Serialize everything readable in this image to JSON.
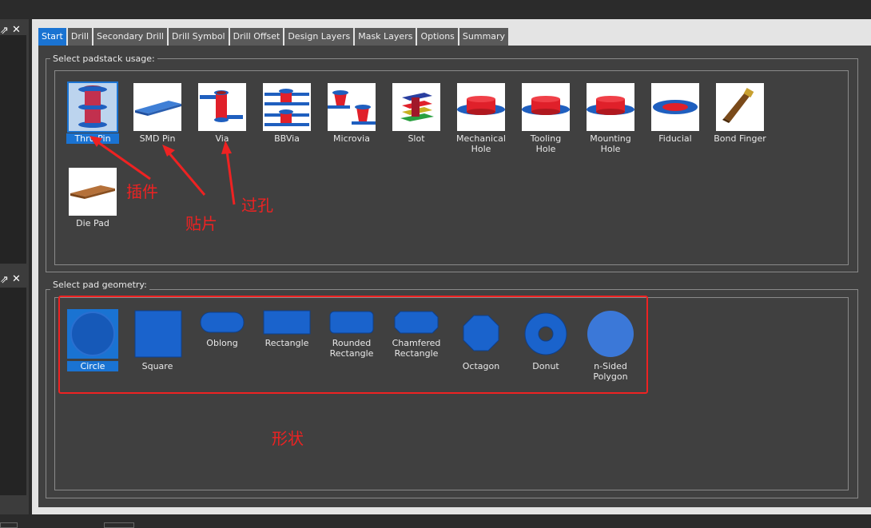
{
  "left_panel": {
    "btn_float": "⇗",
    "btn_close": "✕"
  },
  "tabs": [
    {
      "label": "Start",
      "active": true
    },
    {
      "label": "Drill"
    },
    {
      "label": "Secondary Drill"
    },
    {
      "label": "Drill Symbol"
    },
    {
      "label": "Drill Offset"
    },
    {
      "label": "Design Layers"
    },
    {
      "label": "Mask Layers"
    },
    {
      "label": "Options"
    },
    {
      "label": "Summary"
    }
  ],
  "usage": {
    "title": "Select padstack usage:",
    "items": [
      {
        "label": "Thru Pin",
        "icon": "thru-pin-icon",
        "selected": true
      },
      {
        "label": "SMD Pin",
        "icon": "smd-pin-icon"
      },
      {
        "label": "Via",
        "icon": "via-icon"
      },
      {
        "label": "BBVia",
        "icon": "bbvia-icon"
      },
      {
        "label": "Microvia",
        "icon": "microvia-icon"
      },
      {
        "label": "Slot",
        "icon": "slot-icon"
      },
      {
        "label": "Mechanical Hole",
        "icon": "mechanical-hole-icon"
      },
      {
        "label": "Tooling Hole",
        "icon": "tooling-hole-icon"
      },
      {
        "label": "Mounting Hole",
        "icon": "mounting-hole-icon"
      },
      {
        "label": "Fiducial",
        "icon": "fiducial-icon"
      },
      {
        "label": "Bond Finger",
        "icon": "bond-finger-icon"
      },
      {
        "label": "Die Pad",
        "icon": "die-pad-icon"
      }
    ]
  },
  "geometry": {
    "title": "Select pad geometry:",
    "items": [
      {
        "label": "Circle",
        "icon": "circle-shape-icon",
        "selected": true
      },
      {
        "label": "Square",
        "icon": "square-shape-icon"
      },
      {
        "label": "Oblong",
        "icon": "oblong-shape-icon"
      },
      {
        "label": "Rectangle",
        "icon": "rectangle-shape-icon"
      },
      {
        "label": "Rounded Rectangle",
        "icon": "rounded-rectangle-shape-icon"
      },
      {
        "label": "Chamfered Rectangle",
        "icon": "chamfered-rectangle-shape-icon"
      },
      {
        "label": "Octagon",
        "icon": "octagon-shape-icon"
      },
      {
        "label": "Donut",
        "icon": "donut-shape-icon"
      },
      {
        "label": "n-Sided Polygon",
        "icon": "n-sided-polygon-shape-icon"
      }
    ]
  },
  "annotations": {
    "thru_pin": "插件",
    "smd_pin": "贴片",
    "via": "过孔",
    "shape": "形状"
  },
  "colors": {
    "accent": "#1a73d2",
    "annotation": "#ee2222",
    "pad_red": "#e0202a",
    "pad_blue": "#1f5fbf"
  }
}
